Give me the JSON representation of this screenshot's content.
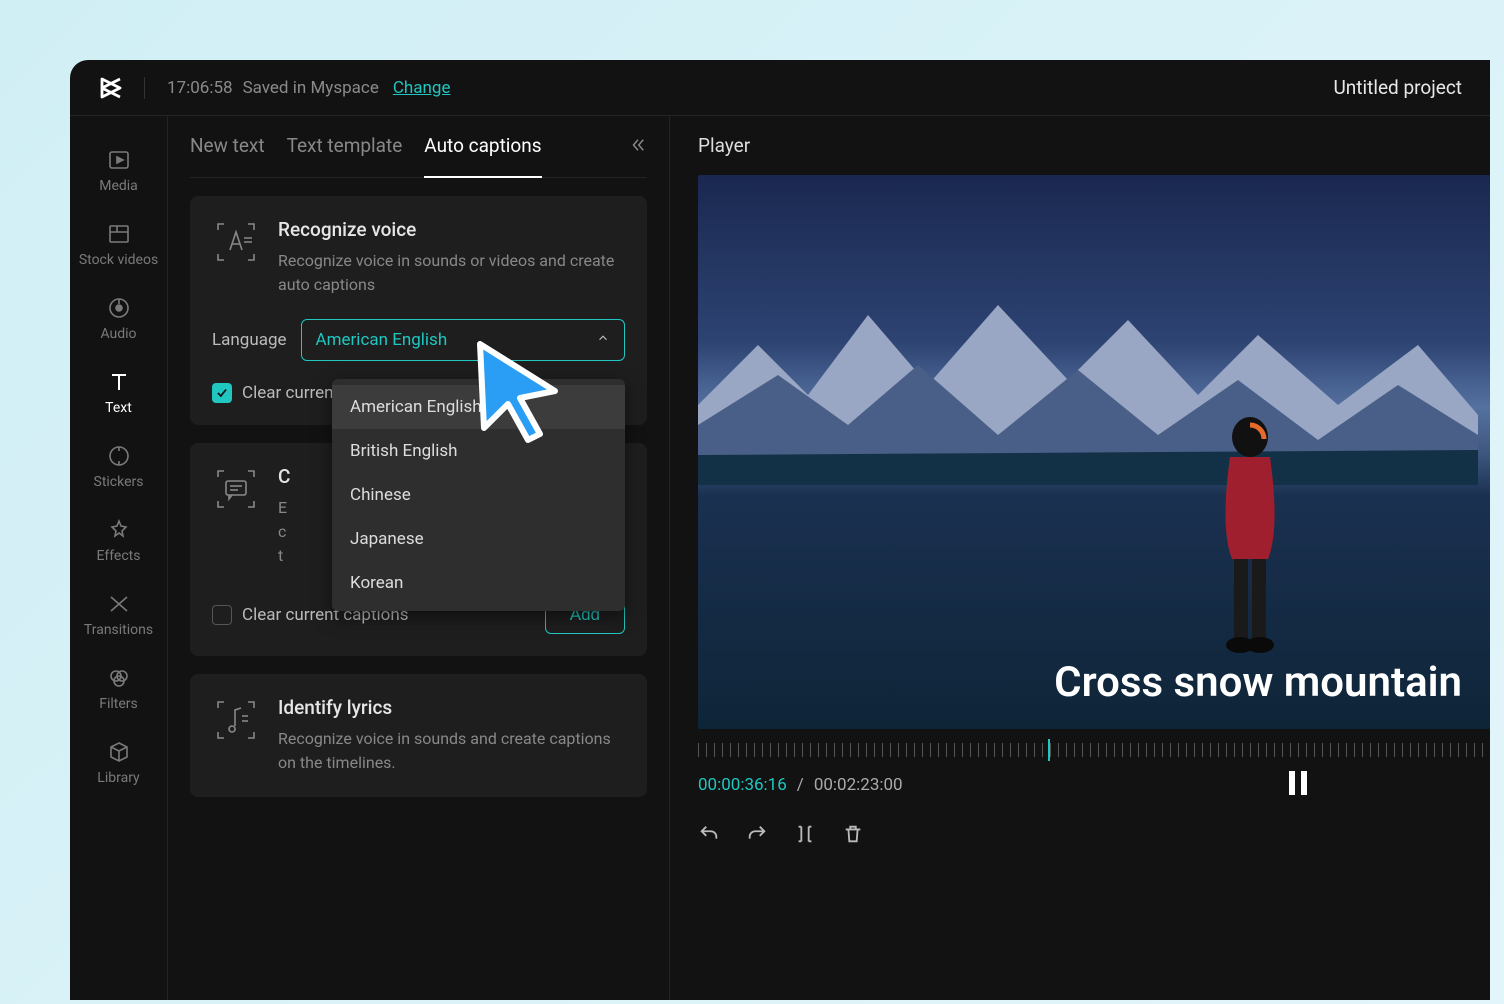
{
  "topbar": {
    "time": "17:06:58",
    "saved": "Saved in Myspace",
    "change": "Change",
    "project_title": "Untitled project"
  },
  "sidebar": {
    "items": [
      {
        "label": "Media"
      },
      {
        "label": "Stock videos"
      },
      {
        "label": "Audio"
      },
      {
        "label": "Text"
      },
      {
        "label": "Stickers"
      },
      {
        "label": "Effects"
      },
      {
        "label": "Transitions"
      },
      {
        "label": "Filters"
      },
      {
        "label": "Library"
      }
    ]
  },
  "tabs": {
    "new_text": "New text",
    "text_template": "Text template",
    "auto_captions": "Auto captions"
  },
  "recognize": {
    "title": "Recognize voice",
    "desc": "Recognize voice in sounds or videos and create auto captions",
    "language_label": "Language",
    "selected": "American English",
    "options": [
      "American English",
      "British English",
      "Chinese",
      "Japanese",
      "Korean"
    ],
    "clear_label": "Clear current captions"
  },
  "card2": {
    "title_initial": "C",
    "clear_label": "Clear current captions",
    "add_label": "Add"
  },
  "identify": {
    "title": "Identify lyrics",
    "desc": "Recognize voice in sounds and create captions on the timelines."
  },
  "player": {
    "title": "Player",
    "caption": "Cross snow mountain",
    "current": "00:00:36:16",
    "total": "00:02:23:00",
    "separator": "/"
  }
}
